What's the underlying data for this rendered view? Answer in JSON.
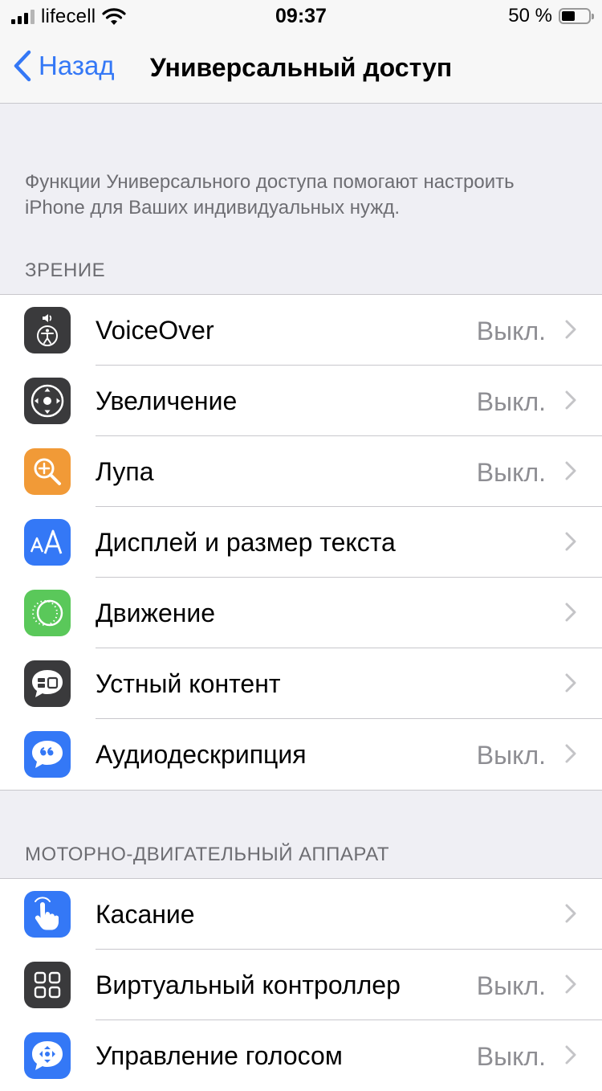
{
  "status_bar": {
    "carrier": "lifecell",
    "time": "09:37",
    "battery_percent": "50 %",
    "battery_level": 0.5
  },
  "nav": {
    "back_label": "Назад",
    "title": "Универсальный доступ"
  },
  "description": "Функции Универсального доступа помогают настроить iPhone для Ваших индивидуальных нужд.",
  "sections": [
    {
      "header": "ЗРЕНИЕ",
      "items": [
        {
          "label": "VoiceOver",
          "value": "Выкл.",
          "icon": "voiceover-icon",
          "color": "#3a3a3c"
        },
        {
          "label": "Увеличение",
          "value": "Выкл.",
          "icon": "zoom-icon",
          "color": "#3a3a3c"
        },
        {
          "label": "Лупа",
          "value": "Выкл.",
          "icon": "magnifier-icon",
          "color": "#f19a37"
        },
        {
          "label": "Дисплей и размер текста",
          "value": "",
          "icon": "text-size-icon",
          "color": "#3478f6"
        },
        {
          "label": "Движение",
          "value": "",
          "icon": "motion-icon",
          "color": "#5ac85a"
        },
        {
          "label": "Устный контент",
          "value": "",
          "icon": "spoken-content-icon",
          "color": "#3a3a3c"
        },
        {
          "label": "Аудиодескрипция",
          "value": "Выкл.",
          "icon": "audio-description-icon",
          "color": "#3478f6"
        }
      ]
    },
    {
      "header": "МОТОРНО-ДВИГАТЕЛЬНЫЙ АППАРАТ",
      "items": [
        {
          "label": "Касание",
          "value": "",
          "icon": "touch-icon",
          "color": "#3478f6"
        },
        {
          "label": "Виртуальный контроллер",
          "value": "Выкл.",
          "icon": "switch-control-icon",
          "color": "#3a3a3c"
        },
        {
          "label": "Управление голосом",
          "value": "Выкл.",
          "icon": "voice-control-icon",
          "color": "#3478f6"
        }
      ]
    }
  ]
}
